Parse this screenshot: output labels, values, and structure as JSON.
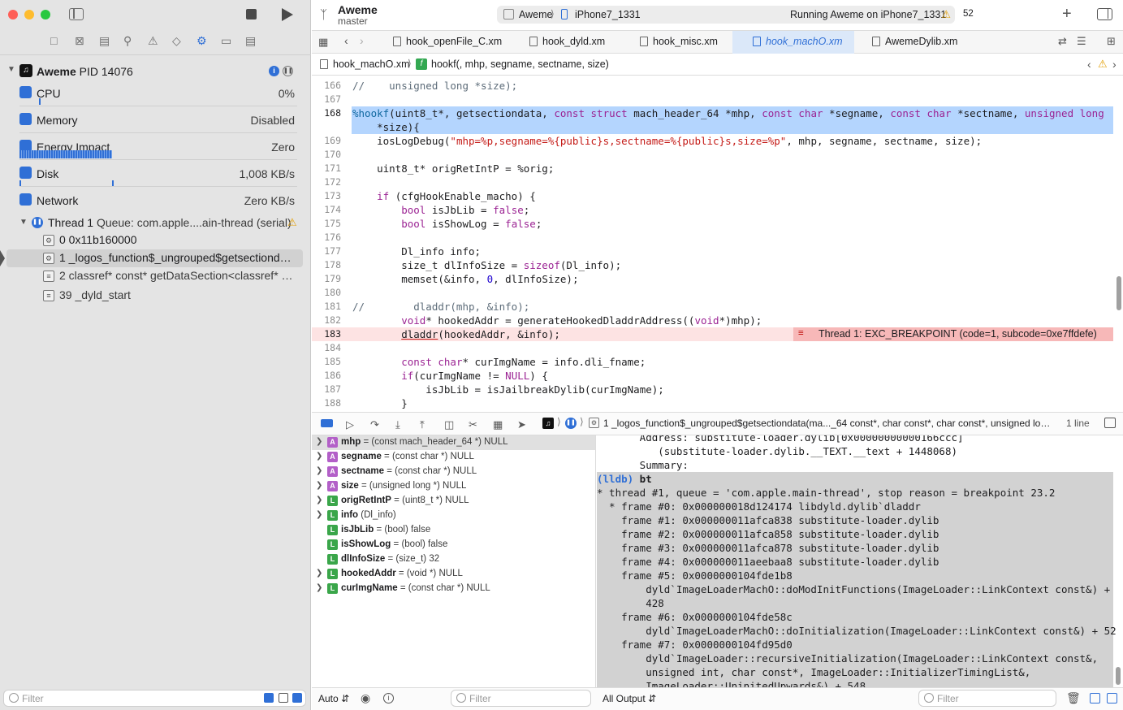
{
  "window": {
    "project_name": "Aweme",
    "branch": "master",
    "scheme": "Aweme",
    "device": "iPhone7_1331",
    "status": "Running Aweme on iPhone7_1331",
    "warning_count": "52"
  },
  "navigator": {
    "process_name": "Aweme",
    "pid": "PID 14076",
    "gauges": [
      {
        "label": "CPU",
        "value": "0%",
        "color": "#2f6fd6"
      },
      {
        "label": "Memory",
        "value": "Disabled",
        "color": "#2f6fd6"
      },
      {
        "label": "Energy Impact",
        "value": "Zero",
        "color": "#2f6fd6"
      },
      {
        "label": "Disk",
        "value": "1,008 KB/s",
        "color": "#2f6fd6"
      },
      {
        "label": "Network",
        "value": "Zero KB/s",
        "color": "#2f6fd6"
      }
    ],
    "thread": {
      "label": "Thread 1",
      "queue": "Queue: com.apple....ain-thread (serial)"
    },
    "frames": [
      {
        "text": "0 0x11b160000",
        "selected": false
      },
      {
        "text": "1 _logos_function$_ungrouped$getsectiondat...",
        "selected": true
      },
      {
        "text": "2 classref* const* getDataSection<classref* c...",
        "selected": false
      },
      {
        "text": "39 _dyld_start",
        "selected": false
      }
    ],
    "filter_placeholder": "Filter"
  },
  "tabs": [
    {
      "label": "hook_openFile_C.xm",
      "active": false
    },
    {
      "label": "hook_dyld.xm",
      "active": false
    },
    {
      "label": "hook_misc.xm",
      "active": false
    },
    {
      "label": "hook_machO.xm",
      "active": true
    },
    {
      "label": "AwemeDylib.xm",
      "active": false
    }
  ],
  "jumpbar": {
    "file": "hook_machO.xm",
    "symbol": "hookf(, mhp, segname, sectname, size)"
  },
  "editor": {
    "breakpoint_message": "Thread 1: EXC_BREAKPOINT (code=1, subcode=0xe7ffdefe)",
    "line_numbers": [
      "166",
      "167",
      "168",
      "",
      "169",
      "170",
      "171",
      "172",
      "173",
      "174",
      "175",
      "176",
      "177",
      "178",
      "179",
      "180",
      "181",
      "182",
      "183",
      "184",
      "185",
      "186",
      "187",
      "188"
    ]
  },
  "debug_bar": {
    "frame_label": "1 _logos_function$_ungrouped$getsectiondata(ma..._64 const*, char const*, char const*, unsigned long*)",
    "line_info": "1 line"
  },
  "variables": [
    {
      "kind": "A",
      "name": "mhp",
      "type": " = (const mach_header_64 *) NULL",
      "expandable": true,
      "selected": true
    },
    {
      "kind": "A",
      "name": "segname",
      "type": " = (const char *) NULL",
      "expandable": true,
      "selected": false
    },
    {
      "kind": "A",
      "name": "sectname",
      "type": " = (const char *) NULL",
      "expandable": true,
      "selected": false
    },
    {
      "kind": "A",
      "name": "size",
      "type": " = (unsigned long *) NULL",
      "expandable": true,
      "selected": false
    },
    {
      "kind": "L",
      "name": "origRetIntP",
      "type": " = (uint8_t *) NULL",
      "expandable": true,
      "selected": false
    },
    {
      "kind": "L",
      "name": "info",
      "type": " (Dl_info)",
      "expandable": true,
      "selected": false
    },
    {
      "kind": "L",
      "name": "isJbLib",
      "type": " = (bool) false",
      "expandable": false,
      "selected": false
    },
    {
      "kind": "L",
      "name": "isShowLog",
      "type": " = (bool) false",
      "expandable": false,
      "selected": false
    },
    {
      "kind": "L",
      "name": "dlInfoSize",
      "type": " = (size_t) 32",
      "expandable": false,
      "selected": false
    },
    {
      "kind": "L",
      "name": "hookedAddr",
      "type": " = (void *) NULL",
      "expandable": true,
      "selected": false
    },
    {
      "kind": "L",
      "name": "curImgName",
      "type": " = (const char *) NULL",
      "expandable": true,
      "selected": false
    }
  ],
  "console_lines": [
    "       Address: substitute-loader.dylib[0x00000000000166ccc]",
    "          (substitute-loader.dylib.__TEXT.__text + 1448068)",
    "       Summary:",
    "(lldb) bt",
    "* thread #1, queue = 'com.apple.main-thread', stop reason = breakpoint 23.2",
    "  * frame #0: 0x000000018d124174 libdyld.dylib`dladdr",
    "    frame #1: 0x000000011afca838 substitute-loader.dylib",
    "    frame #2: 0x000000011afca858 substitute-loader.dylib",
    "    frame #3: 0x000000011afca878 substitute-loader.dylib",
    "    frame #4: 0x000000011aeebaa8 substitute-loader.dylib",
    "    frame #5: 0x0000000104fde1b8",
    "        dyld`ImageLoaderMachO::doModInitFunctions(ImageLoader::LinkContext const&) +",
    "        428",
    "    frame #6: 0x0000000104fde58c",
    "        dyld`ImageLoaderMachO::doInitialization(ImageLoader::LinkContext const&) + 52",
    "    frame #7: 0x0000000104fd95d0",
    "        dyld`ImageLoader::recursiveInitialization(ImageLoader::LinkContext const&,",
    "        unsigned int, char const*, ImageLoader::InitializerTimingList&,",
    "        ImageLoader::UninitedUpwards&) + 548"
  ],
  "bottom": {
    "auto_label": "Auto",
    "var_filter": "Filter",
    "output_label": "All Output",
    "console_filter": "Filter"
  }
}
